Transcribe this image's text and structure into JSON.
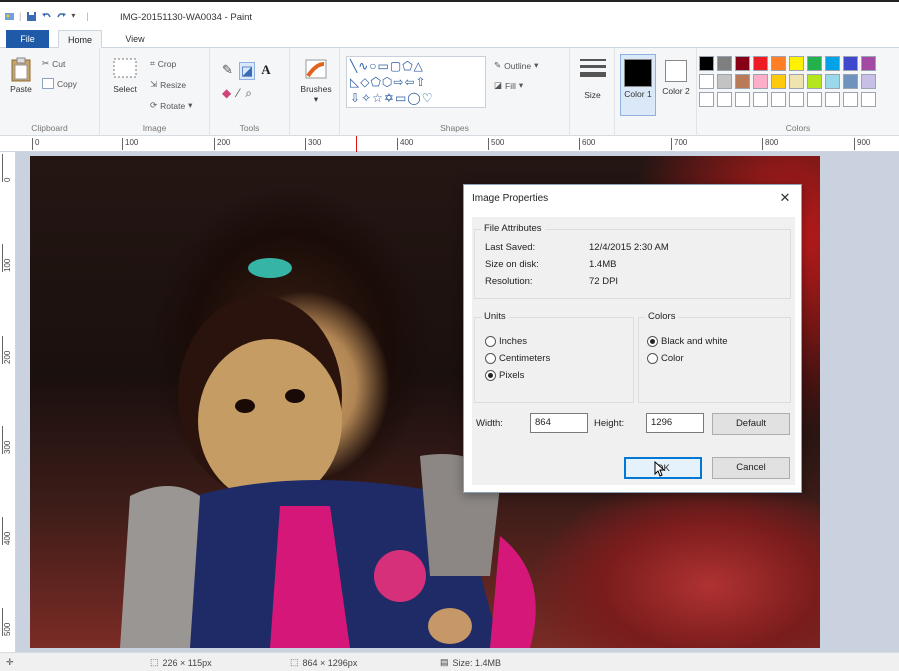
{
  "window": {
    "title": "IMG-20151130-WA0034 - Paint"
  },
  "tabs": {
    "file": "File",
    "home": "Home",
    "view": "View"
  },
  "ribbon": {
    "clipboard": {
      "paste": "Paste",
      "cut": "Cut",
      "copy": "Copy",
      "label": "Clipboard"
    },
    "image": {
      "select": "Select",
      "crop": "Crop",
      "resize": "Resize",
      "rotate": "Rotate",
      "label": "Image"
    },
    "tools": {
      "label": "Tools"
    },
    "brushes": {
      "label": "Brushes"
    },
    "shapes": {
      "outline": "Outline",
      "fill": "Fill",
      "label": "Shapes"
    },
    "size": {
      "label": "Size"
    },
    "color1": {
      "label": "Color 1"
    },
    "color2": {
      "label": "Color 2"
    },
    "colors": {
      "label": "Colors",
      "swatches": [
        "#000000",
        "#7f7f7f",
        "#880015",
        "#ed1c24",
        "#ff7f27",
        "#fff200",
        "#22b14c",
        "#00a2e8",
        "#3f48cc",
        "#a349a4",
        "#ffffff",
        "#c3c3c3",
        "#b97a57",
        "#ffaec9",
        "#ffc90e",
        "#efe4b0",
        "#b5e61d",
        "#99d9ea",
        "#7092be",
        "#c8bfe7",
        "#ffffff",
        "#ffffff",
        "#ffffff",
        "#ffffff",
        "#ffffff",
        "#ffffff",
        "#ffffff",
        "#ffffff",
        "#ffffff",
        "#ffffff"
      ]
    }
  },
  "ruler": {
    "top": [
      "0",
      "100",
      "200",
      "300",
      "400",
      "500",
      "600",
      "700",
      "800",
      "900"
    ],
    "left": [
      "0",
      "100",
      "200",
      "300",
      "400",
      "500"
    ]
  },
  "dialog": {
    "title": "Image Properties",
    "close": "✕",
    "file_attributes": {
      "legend": "File Attributes",
      "last_saved_label": "Last Saved:",
      "last_saved_value": "12/4/2015 2:30 AM",
      "size_label": "Size on disk:",
      "size_value": "1.4MB",
      "resolution_label": "Resolution:",
      "resolution_value": "72 DPI"
    },
    "units": {
      "legend": "Units",
      "options": [
        "Inches",
        "Centimeters",
        "Pixels"
      ],
      "selected": "Pixels"
    },
    "colors": {
      "legend": "Colors",
      "options": [
        "Black and white",
        "Color"
      ],
      "selected": "Black and white"
    },
    "width_label": "Width:",
    "width_value": "864",
    "height_label": "Height:",
    "height_value": "1296",
    "default_button": "Default",
    "ok_button": "OK",
    "cancel_button": "Cancel"
  },
  "statusbar": {
    "selection": "226 × 115px",
    "image_size": "864 × 1296px",
    "file_size": "Size: 1.4MB"
  }
}
